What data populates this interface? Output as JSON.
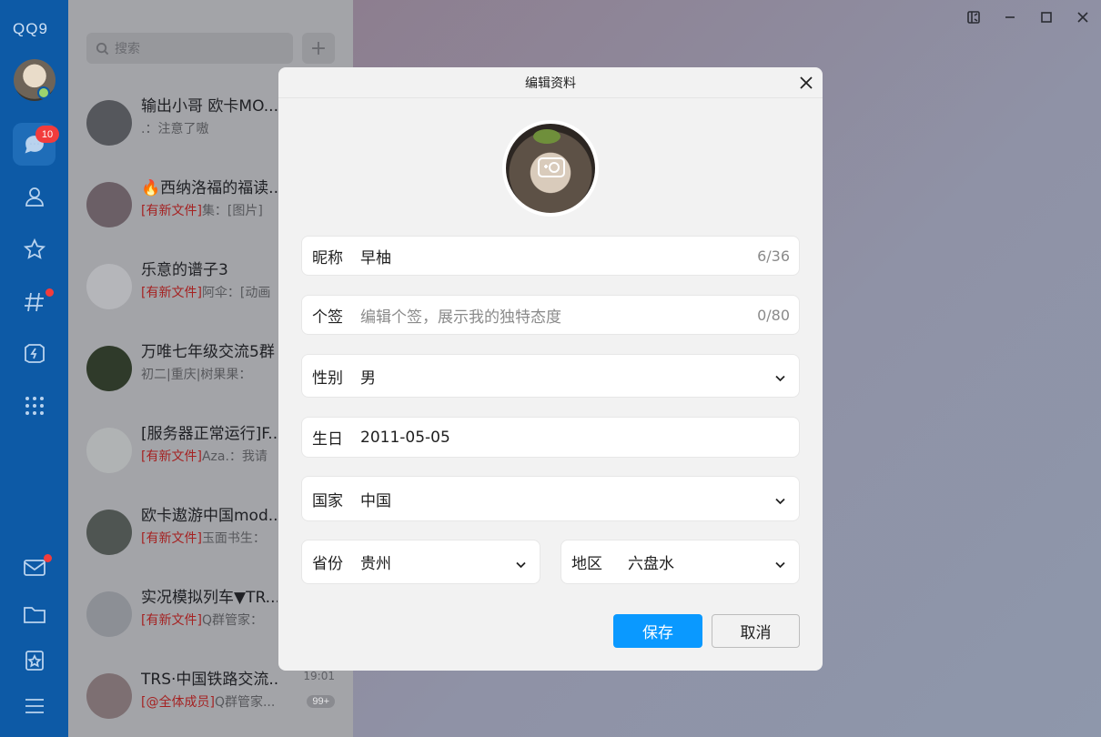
{
  "app": {
    "logo_text": "QQ9",
    "unread_badge": "10"
  },
  "search": {
    "placeholder": "搜索",
    "add_symbol": "+"
  },
  "chats": [
    {
      "title": "输出小哥 欧卡MO...",
      "tag": "",
      "preview": ".：注意了嗷",
      "time": "",
      "count": ""
    },
    {
      "title": "🔥西纳洛福的福读...",
      "tag": "[有新文件]",
      "preview": "集：[图片]",
      "time": "",
      "count": ""
    },
    {
      "title": "乐意的谱子3",
      "tag": "[有新文件]",
      "preview": "阿伞：[动画",
      "time": "",
      "count": ""
    },
    {
      "title": "万唯七年级交流5群",
      "tag": "",
      "preview": "初二|重庆|树果果：",
      "time": "",
      "count": ""
    },
    {
      "title": "[服务器正常运行]F...",
      "tag": "[有新文件]",
      "preview": "Aza.：我请",
      "time": "",
      "count": ""
    },
    {
      "title": "欧卡遨游中国mod...",
      "tag": "[有新文件]",
      "preview": "玉面书生：",
      "time": "",
      "count": ""
    },
    {
      "title": "实况模拟列车▼TR...",
      "tag": "[有新文件]",
      "preview": "Q群管家：",
      "time": "",
      "count": ""
    },
    {
      "title": "TRS·中国铁路交流...",
      "tag": "[@全体成员]",
      "preview": "Q群管家...",
      "time": "19:01",
      "count": "99+"
    }
  ],
  "modal": {
    "title": "编辑资料",
    "nickname": {
      "label": "昵称",
      "value": "早柚",
      "count": "6/36"
    },
    "signature": {
      "label": "个签",
      "placeholder": "编辑个签，展示我的独特态度",
      "count": "0/80"
    },
    "gender": {
      "label": "性别",
      "value": "男"
    },
    "birthday": {
      "label": "生日",
      "value": "2011-05-05"
    },
    "country": {
      "label": "国家",
      "value": "中国"
    },
    "province": {
      "label": "省份",
      "value": "贵州"
    },
    "region": {
      "label": "地区",
      "value": "六盘水"
    },
    "save_label": "保存",
    "cancel_label": "取消"
  },
  "colors": {
    "rail": "#0d5aa6",
    "accent": "#0a99ff",
    "badge": "#f23c3c",
    "file_tag": "#a52222"
  },
  "icons": [
    "chat-icon",
    "contacts-icon",
    "star-icon",
    "channel-icon",
    "game-icon",
    "apps-grid-icon",
    "mail-icon",
    "folder-icon",
    "favorites-icon",
    "menu-icon",
    "camera-icon",
    "close-icon",
    "chevron-down-icon",
    "search-icon",
    "pin-window-icon",
    "minimize-icon",
    "maximize-icon"
  ]
}
